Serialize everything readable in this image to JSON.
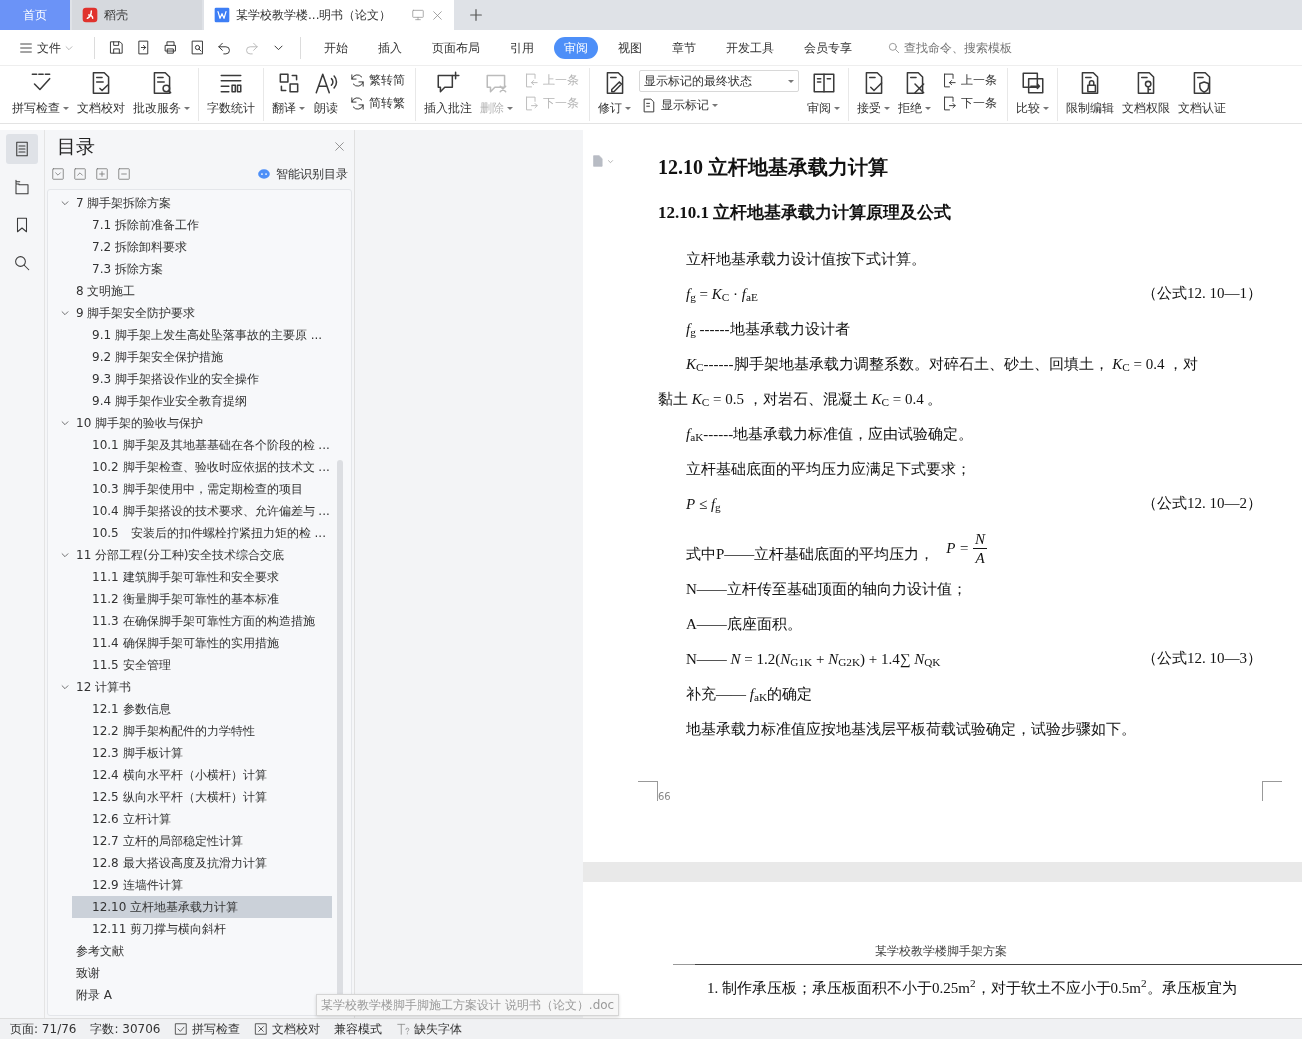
{
  "tabs": [
    {
      "label": "首页",
      "kind": "home",
      "selected": false
    },
    {
      "label": "稻壳",
      "kind": "app",
      "selected": false
    },
    {
      "label": "某学校教学楼...明书（论文）",
      "kind": "doc",
      "selected": true
    }
  ],
  "menu": {
    "file": "文件",
    "items": [
      {
        "label": "开始",
        "selected": false
      },
      {
        "label": "插入",
        "selected": false
      },
      {
        "label": "页面布局",
        "selected": false
      },
      {
        "label": "引用",
        "selected": false
      },
      {
        "label": "审阅",
        "selected": true
      },
      {
        "label": "视图",
        "selected": false
      },
      {
        "label": "章节",
        "selected": false
      },
      {
        "label": "开发工具",
        "selected": false
      },
      {
        "label": "会员专享",
        "selected": false
      }
    ],
    "search": {
      "placeholder": "查找命令、搜索模板"
    }
  },
  "ribbon": {
    "groups": [
      [
        {
          "kind": "large",
          "label": "拼写检查",
          "dropdown": true,
          "disabled": false
        },
        {
          "kind": "large",
          "label": "文档校对",
          "dropdown": false,
          "disabled": false
        },
        {
          "kind": "large",
          "label": "批改服务",
          "dropdown": true,
          "disabled": false
        }
      ],
      [
        {
          "kind": "large",
          "label": "字数统计",
          "dropdown": false,
          "disabled": false
        }
      ],
      [
        {
          "kind": "large",
          "label": "翻译",
          "dropdown": true,
          "disabled": false
        },
        {
          "kind": "large",
          "label": "朗读",
          "dropdown": false,
          "disabled": false
        },
        {
          "kind": "stack",
          "items": [
            {
              "kind": "small",
              "label": "繁转简",
              "dropdown": false,
              "disabled": false
            },
            {
              "kind": "small",
              "label": "简转繁",
              "dropdown": false,
              "disabled": false
            }
          ]
        }
      ],
      [
        {
          "kind": "large",
          "label": "插入批注",
          "dropdown": false,
          "disabled": false
        },
        {
          "kind": "large",
          "label": "删除",
          "dropdown": true,
          "disabled": true
        },
        {
          "kind": "stack",
          "items": [
            {
              "kind": "small",
              "label": "上一条",
              "dropdown": false,
              "disabled": true
            },
            {
              "kind": "small",
              "label": "下一条",
              "dropdown": false,
              "disabled": true
            }
          ]
        }
      ],
      [
        {
          "kind": "large",
          "label": "修订",
          "dropdown": true,
          "disabled": false
        },
        {
          "kind": "stack",
          "items": [
            {
              "kind": "select",
              "label": "显示标记的最终状态",
              "dropdown": true,
              "disabled": false
            },
            {
              "kind": "small",
              "label": "显示标记",
              "dropdown": true,
              "disabled": false
            }
          ]
        },
        {
          "kind": "large",
          "label": "审阅",
          "dropdown": true,
          "disabled": false
        }
      ],
      [
        {
          "kind": "large",
          "label": "接受",
          "dropdown": true,
          "disabled": false
        },
        {
          "kind": "large",
          "label": "拒绝",
          "dropdown": true,
          "disabled": false
        },
        {
          "kind": "stack",
          "items": [
            {
              "kind": "small",
              "label": "上一条",
              "dropdown": false,
              "disabled": false
            },
            {
              "kind": "small",
              "label": "下一条",
              "dropdown": false,
              "disabled": false
            }
          ]
        }
      ],
      [
        {
          "kind": "large",
          "label": "比较",
          "dropdown": true,
          "disabled": false
        }
      ],
      [
        {
          "kind": "large",
          "label": "限制编辑",
          "dropdown": false,
          "disabled": false
        },
        {
          "kind": "large",
          "label": "文档权限",
          "dropdown": false,
          "disabled": false
        },
        {
          "kind": "large",
          "label": "文档认证",
          "dropdown": false,
          "disabled": false
        }
      ]
    ]
  },
  "sidebar": {
    "items": [
      {
        "selected": true
      },
      {
        "selected": false
      },
      {
        "selected": false
      },
      {
        "selected": false
      }
    ]
  },
  "toc": {
    "title": "目录",
    "smart_button": "智能识别目录",
    "items": [
      {
        "label": "7 脚手架拆除方案",
        "expanded": true,
        "selected": false,
        "children": [
          {
            "label": "7.1 拆除前准备工作",
            "selected": false
          },
          {
            "label": "7.2 拆除卸料要求",
            "selected": false
          },
          {
            "label": "7.3 拆除方案",
            "selected": false
          }
        ]
      },
      {
        "label": "8 文明施工",
        "selected": false
      },
      {
        "label": "9 脚手架安全防护要求",
        "expanded": true,
        "selected": false,
        "children": [
          {
            "label": "9.1 脚手架上发生高处坠落事故的主要原 ...",
            "selected": false
          },
          {
            "label": "9.2 脚手架安全保护措施",
            "selected": false
          },
          {
            "label": "9.3 脚手架搭设作业的安全操作",
            "selected": false
          },
          {
            "label": "9.4 脚手架作业安全教育提纲",
            "selected": false
          }
        ]
      },
      {
        "label": "10 脚手架的验收与保护",
        "expanded": true,
        "selected": false,
        "children": [
          {
            "label": "10.1 脚手架及其地基基础在各个阶段的检 ...",
            "selected": false
          },
          {
            "label": "10.2 脚手架检查、验收时应依据的技术文 ...",
            "selected": false
          },
          {
            "label": "10.3 脚手架使用中，需定期检查的项目",
            "selected": false
          },
          {
            "label": "10.4 脚手架搭设的技术要求、允许偏差与 ...",
            "selected": false
          },
          {
            "label": "10.5　安装后的扣件螺栓拧紧扭力矩的检 ...",
            "selected": false
          }
        ]
      },
      {
        "label": "11 分部工程(分工种)安全技术综合交底",
        "expanded": true,
        "selected": false,
        "children": [
          {
            "label": "11.1 建筑脚手架可靠性和安全要求",
            "selected": false
          },
          {
            "label": "11.2 衡量脚手架可靠性的基本标准",
            "selected": false
          },
          {
            "label": "11.3 在确保脚手架可靠性方面的构造措施",
            "selected": false
          },
          {
            "label": "11.4 确保脚手架可靠性的实用措施",
            "selected": false
          },
          {
            "label": "11.5 安全管理",
            "selected": false
          }
        ]
      },
      {
        "label": "12 计算书",
        "expanded": true,
        "selected": false,
        "children": [
          {
            "label": "12.1 参数信息",
            "selected": false
          },
          {
            "label": "12.2 脚手架构配件的力学特性",
            "selected": false
          },
          {
            "label": "12.3 脚手板计算",
            "selected": false
          },
          {
            "label": "12.4 横向水平杆（小横杆）计算",
            "selected": false
          },
          {
            "label": "12.5 纵向水平杆（大横杆）计算",
            "selected": false
          },
          {
            "label": "12.6 立杆计算",
            "selected": false
          },
          {
            "label": "12.7 立杆的局部稳定性计算",
            "selected": false
          },
          {
            "label": "12.8 最大搭设高度及抗滑力计算",
            "selected": false
          },
          {
            "label": "12.9 连墙件计算",
            "selected": false
          },
          {
            "label": "12.10 立杆地基承载力计算",
            "selected": true
          },
          {
            "label": "12.11 剪刀撑与横向斜杆",
            "selected": false
          }
        ]
      },
      {
        "label": "参考文献",
        "selected": false
      },
      {
        "label": "致谢",
        "selected": false
      },
      {
        "label": "附录 A",
        "selected": false
      }
    ]
  },
  "page": {
    "heading": "12.10 立杆地基承载力计算",
    "subheading": "12.10.1 立杆地基承载力计算原理及公式",
    "paragraphs": [
      {
        "kind": "text",
        "indent": true,
        "text": "立杆地基承载力设计值按下式计算。"
      },
      {
        "kind": "formula",
        "indent": true,
        "text": "*f*$_{g}$ = *K*$_{C}$ · *f*$_{aE}$",
        "number": "（公式12. 10—1）"
      },
      {
        "kind": "text",
        "indent": true,
        "text": "*f*$_{g}$  ------地基承载力设计者"
      },
      {
        "kind": "text",
        "indent": true,
        "text": " *K*$_{C}$------脚手架地基承载力调整系数。对碎石土、砂土、回填土， *K*$_{C}$ = 0.4 ，对"
      },
      {
        "kind": "text",
        "indent": false,
        "text": "黏土 *K*$_{C}$ = 0.5 ，对岩石、混凝土 *K*$_{C}$ = 0.4 。"
      },
      {
        "kind": "text",
        "indent": true,
        "text": "*f*$_{aK}$------地基承载力标准值，应由试验确定。"
      },
      {
        "kind": "text",
        "indent": true,
        "text": "立杆基础底面的平均压力应满足下式要求；"
      },
      {
        "kind": "formula",
        "indent": true,
        "text": "*P* ≤ *f*$_{g}$",
        "number": "（公式12. 10—2）"
      },
      {
        "kind": "fraction",
        "indent": true,
        "text": "式中P——立杆基础底面的平均压力，",
        "lhs": "P =",
        "numerator": "N",
        "denominator": "A"
      },
      {
        "kind": "text",
        "indent": true,
        "text": "N——立杆传至基础顶面的轴向力设计值；"
      },
      {
        "kind": "text",
        "indent": true,
        "text": "A——底座面积。"
      },
      {
        "kind": "formula",
        "indent": true,
        "text": "N—— *N* = 1.2(*N*$_{G1K}$ + *N*$_{G2K}$) + 1.4∑ *N*$_{QK}$",
        "number": "（公式12. 10—3）"
      },
      {
        "kind": "text",
        "indent": true,
        "text": "补充—— *f*$_{aK}$的确定"
      },
      {
        "kind": "text",
        "indent": true,
        "text": "地基承载力标准值应按地基浅层平板荷载试验确定，试验步骤如下。"
      }
    ],
    "page_number": "66"
  },
  "next_page": {
    "header": "某学校教学楼脚手架方案",
    "text": "1.  制作承压板；承压板面积不小于0.25m$^{2}$，对于软土不应小于0.5m$^{2}$。承压板宜为"
  },
  "tooltip": "某学校教学楼脚手脚施工方案设计 说明书（论文）.doc",
  "status_bar": [
    {
      "kind": "text",
      "label": "页面: 71/76"
    },
    {
      "kind": "text",
      "label": "字数: 30706"
    },
    {
      "kind": "check",
      "label": "拼写检查"
    },
    {
      "kind": "cross",
      "label": "文档校对"
    },
    {
      "kind": "text",
      "label": "兼容模式"
    },
    {
      "kind": "font",
      "label": "缺失字体"
    }
  ]
}
